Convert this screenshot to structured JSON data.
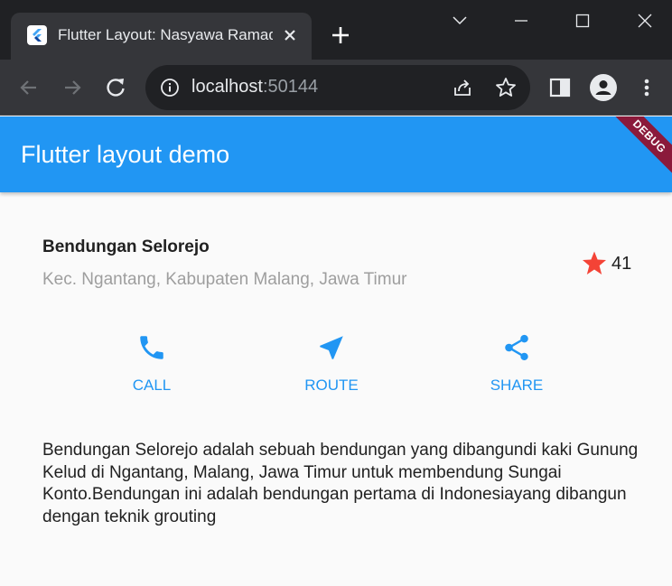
{
  "browser": {
    "tab": {
      "title": "Flutter Layout: Nasyawa Ramadhani"
    },
    "address": {
      "host": "localhost",
      "port": ":50144"
    },
    "icons": {
      "favicon": "flutter-logo-icon",
      "tab_close": "close-icon",
      "new_tab": "plus-icon",
      "tab_search": "chevron-down-icon",
      "minimize": "minimize-icon",
      "maximize": "maximize-icon",
      "close_window": "close-icon",
      "back": "arrow-left-icon",
      "forward": "arrow-right-icon",
      "reload": "reload-icon",
      "site_info": "info-icon",
      "share": "share-icon",
      "bookmark": "star-outline-icon",
      "side_panel": "side-panel-icon",
      "profile": "account-icon",
      "menu": "more-vert-icon"
    }
  },
  "app": {
    "appbar_title": "Flutter layout demo",
    "debug_banner": "DEBUG",
    "title_section": {
      "name": "Bendungan Selorejo",
      "location": "Kec. Ngantang, Kabupaten Malang, Jawa Timur",
      "rating": "41",
      "star_icon": "star-icon"
    },
    "buttons": [
      {
        "label": "CALL",
        "icon": "phone-icon"
      },
      {
        "label": "ROUTE",
        "icon": "near-me-icon"
      },
      {
        "label": "SHARE",
        "icon": "share-icon"
      }
    ],
    "description": "Bendungan Selorejo adalah sebuah bendungan yang dibangundi kaki Gunung Kelud di Ngantang, Malang, Jawa Timur untuk membendung Sungai Konto.Bendungan ini adalah bendungan pertama di Indonesiayang dibangun dengan teknik grouting"
  },
  "colors": {
    "primary": "#2196f3",
    "star": "#f44336",
    "debug_banner": "#8b1a3b",
    "chrome_dark": "#202124",
    "chrome_toolbar": "#35363a"
  }
}
